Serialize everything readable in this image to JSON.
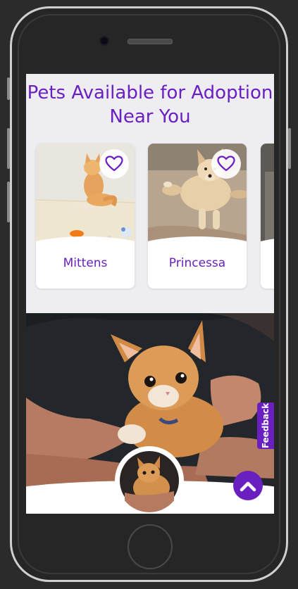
{
  "page": {
    "title": "Pets Available for Adoption Near You"
  },
  "pets": [
    {
      "name": "Mittens",
      "icon": "heart-outline-icon"
    },
    {
      "name": "Princessa",
      "icon": "heart-outline-icon"
    }
  ],
  "feedback": {
    "label": "Feedback"
  },
  "colors": {
    "accent": "#6a1fc0",
    "background": "#eeeef2"
  },
  "icons": {
    "scroll_top": "chevron-up-icon",
    "favorite": "heart-outline-icon"
  }
}
